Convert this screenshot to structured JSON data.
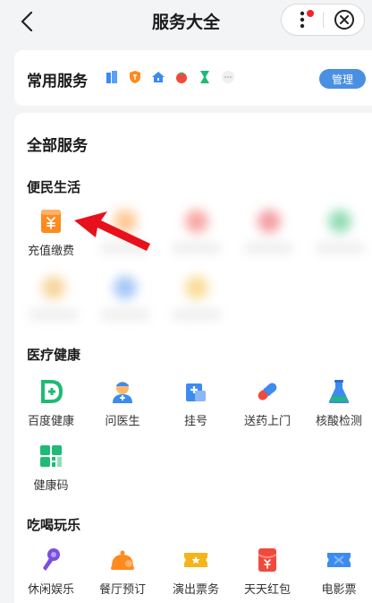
{
  "header": {
    "title": "服务大全"
  },
  "common": {
    "title": "常用服务",
    "manage_label": "管理"
  },
  "all": {
    "title": "全部服务"
  },
  "sections": {
    "life": {
      "title": "便民生活",
      "item0": "充值缴费"
    },
    "medical": {
      "title": "医疗健康",
      "items": [
        "百度健康",
        "问医生",
        "挂号",
        "送药上门",
        "核酸检测",
        "健康码"
      ]
    },
    "fun": {
      "title": "吃喝玩乐",
      "items": [
        "休闲娱乐",
        "餐厅预订",
        "演出票务",
        "天天红包",
        "电影票"
      ]
    }
  },
  "colors": {
    "accent": "#4a90e2",
    "orange": "#ff8a1f",
    "green": "#1fba76",
    "red": "#f5222d"
  }
}
